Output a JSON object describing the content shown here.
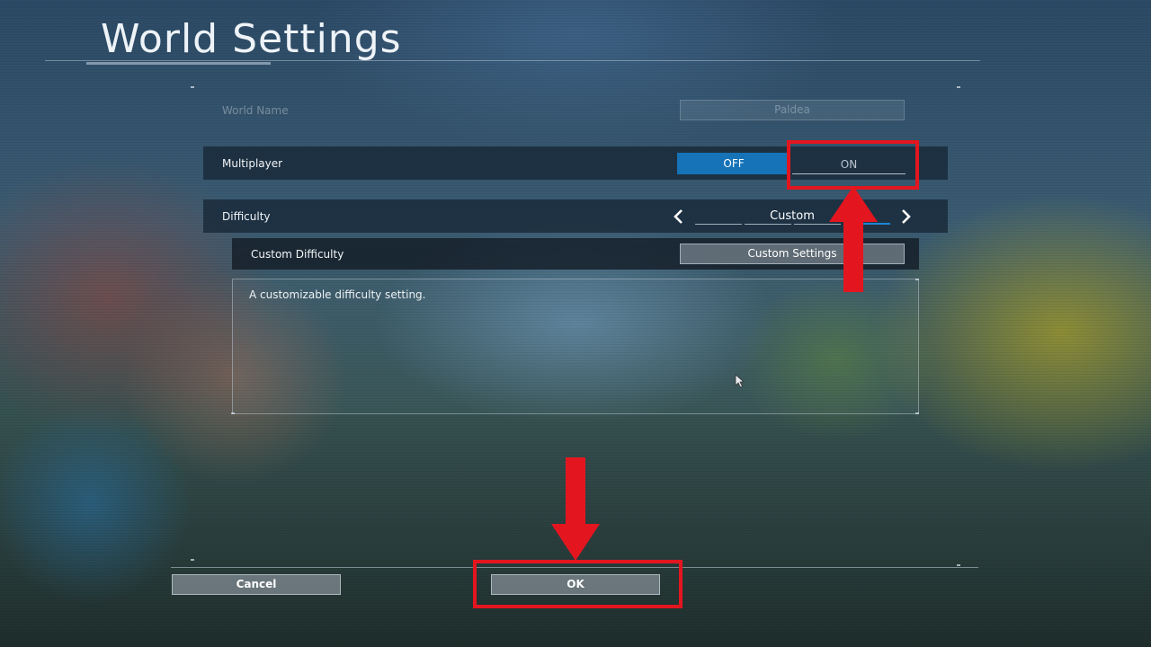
{
  "header": {
    "title": "World Settings"
  },
  "world_name": {
    "label": "World Name",
    "value": "Paldea"
  },
  "multiplayer": {
    "label": "Multiplayer",
    "off_label": "OFF",
    "on_label": "ON",
    "selected": "OFF"
  },
  "difficulty": {
    "label": "Difficulty",
    "value": "Custom",
    "prev_icon": "chevron-left-icon",
    "next_icon": "chevron-right-icon"
  },
  "custom_difficulty": {
    "label": "Custom Difficulty",
    "button_label": "Custom Settings"
  },
  "description": {
    "text": "A customizable difficulty setting."
  },
  "footer": {
    "cancel_label": "Cancel",
    "ok_label": "OK"
  },
  "colors": {
    "accent": "#1673b8",
    "annotation": "#e3161f"
  }
}
